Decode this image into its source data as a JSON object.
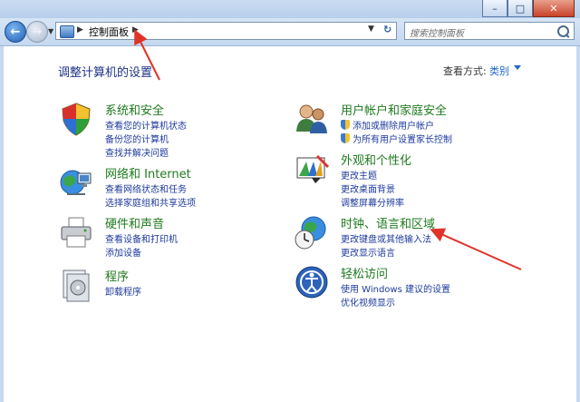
{
  "search": {
    "placeholder": "搜索控制面板"
  },
  "address": {
    "crumb": "控制面板"
  },
  "page": {
    "title": "调整计算机的设置",
    "view_by_label": "查看方式:",
    "view_by_value": "类别"
  },
  "categories": [
    {
      "title": "系统和安全",
      "links": [
        "查看您的计算机状态",
        "备份您的计算机",
        "查找并解决问题"
      ]
    },
    {
      "title": "网络和 Internet",
      "links": [
        "查看网络状态和任务",
        "选择家庭组和共享选项"
      ]
    },
    {
      "title": "硬件和声音",
      "links": [
        "查看设备和打印机",
        "添加设备"
      ]
    },
    {
      "title": "程序",
      "links": [
        "卸载程序"
      ]
    },
    {
      "title": "用户帐户和家庭安全",
      "links": [
        "添加或删除用户帐户",
        "为所有用户设置家长控制"
      ]
    },
    {
      "title": "外观和个性化",
      "links": [
        "更改主题",
        "更改桌面背景",
        "调整屏幕分辨率"
      ]
    },
    {
      "title": "时钟、语言和区域",
      "links": [
        "更改键盘或其他输入法",
        "更改显示语言"
      ]
    },
    {
      "title": "轻松访问",
      "links": [
        "使用 Windows 建议的设置",
        "优化视频显示"
      ]
    }
  ],
  "colors": {
    "category_title": "#1f7a1f",
    "link": "#1e3a9c",
    "annotation_arrow": "#e0332a"
  }
}
